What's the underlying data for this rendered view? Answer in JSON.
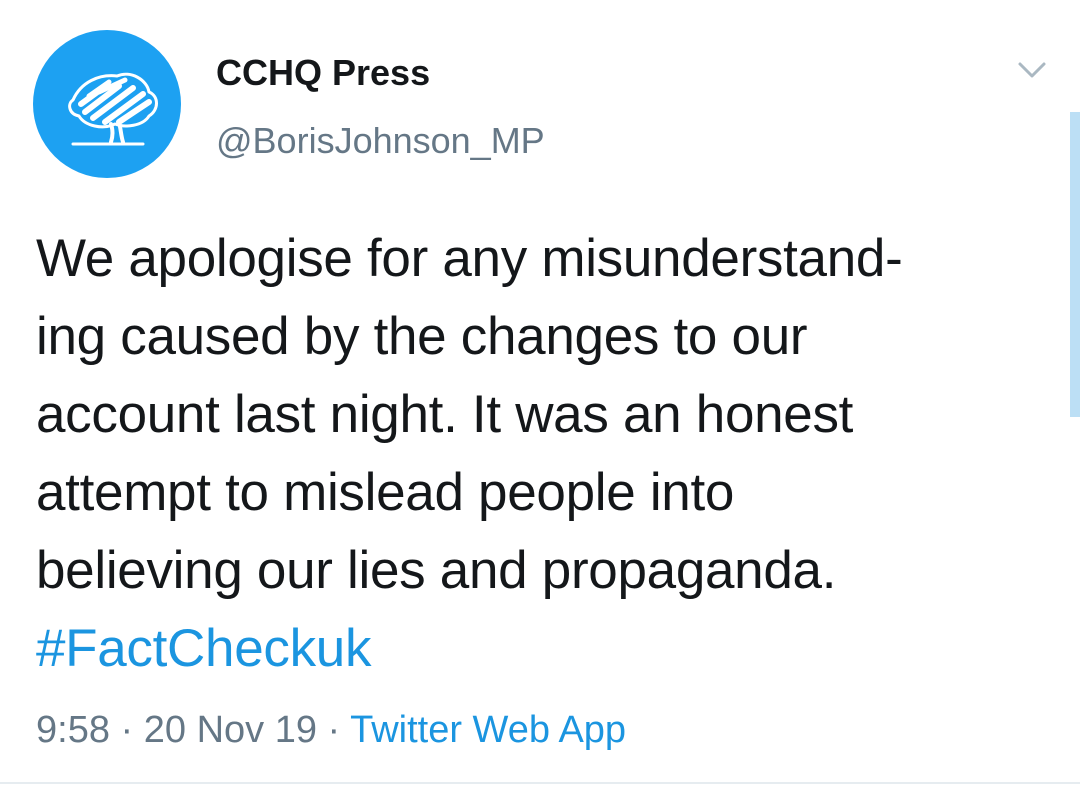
{
  "author": {
    "display_name": "CCHQ Press",
    "handle": "@BorisJohnson_MP",
    "avatar_icon": "conservative-tree-logo-icon",
    "avatar_color": "#1da1f2"
  },
  "menu_icon": "chevron-down-icon",
  "tweet": {
    "lines": [
      "We apologise for any misunderstand-",
      "ing caused by the changes to our",
      "account last night. It was an honest",
      "attempt to mislead people into",
      "believing our lies and propaganda."
    ],
    "hashtag": "#FactCheckuk"
  },
  "meta": {
    "time": "9:58",
    "separator": " · ",
    "date": "20 Nov 19",
    "source": "Twitter Web App"
  },
  "colors": {
    "text": "#14171a",
    "secondary": "#657786",
    "link": "#1b95e0"
  }
}
